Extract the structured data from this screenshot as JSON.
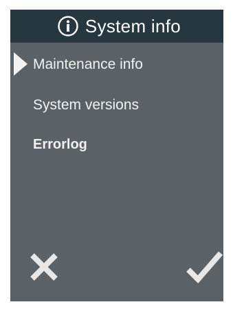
{
  "header": {
    "icon": "info-circle-icon",
    "title": "System info"
  },
  "menu": {
    "items": [
      {
        "label": "Maintenance info",
        "selected": true
      },
      {
        "label": "System versions",
        "selected": false
      },
      {
        "label": "Errorlog",
        "selected": false
      }
    ]
  },
  "footer": {
    "cancel_icon": "close-icon",
    "confirm_icon": "checkmark-icon"
  },
  "colors": {
    "header_bg": "#273740",
    "panel_bg": "#5a6268",
    "text": "#f2f2f2",
    "icon": "#e8e8e8"
  }
}
